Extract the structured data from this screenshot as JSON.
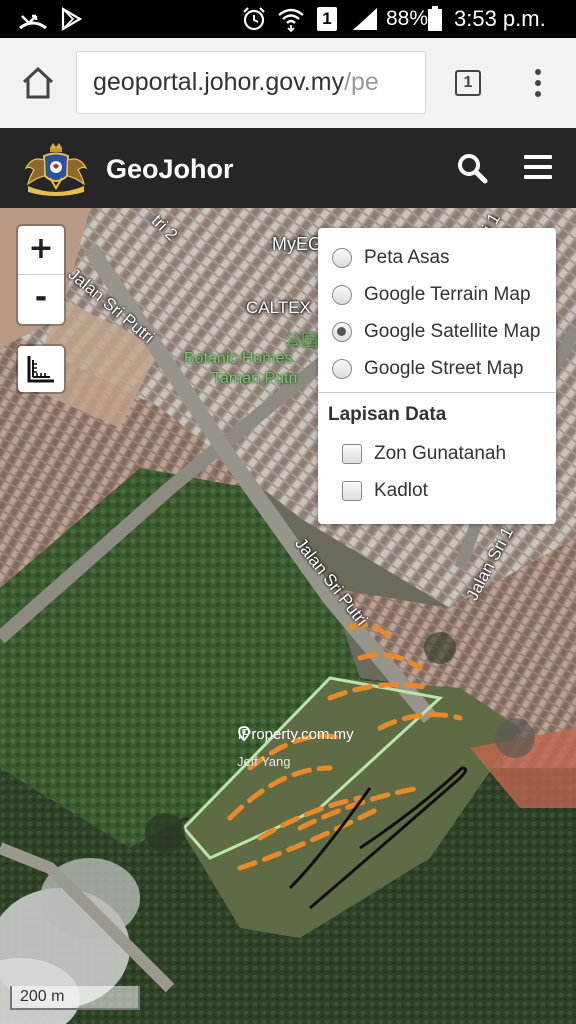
{
  "status_bar": {
    "battery_percent": "88%",
    "time": "3:53 p.m.",
    "sim_indicator": "1",
    "icons": [
      "missed-call-icon",
      "play-store-icon",
      "alarm-icon",
      "wifi-icon",
      "sim-icon",
      "signal-icon",
      "battery-icon"
    ]
  },
  "browser": {
    "url_host": "geoportal.johor.gov.my",
    "url_path": "/pe",
    "tab_count": "1",
    "icons": [
      "home-icon",
      "tabs-icon",
      "overflow-menu-icon"
    ]
  },
  "site": {
    "title": "GeoJohor",
    "icons": [
      "johor-crest-logo",
      "search-icon",
      "hamburger-menu-icon"
    ]
  },
  "map": {
    "zoom_in_label": "+",
    "zoom_out_label": "-",
    "base_layers": [
      {
        "label": "Peta Asas",
        "selected": false
      },
      {
        "label": "Google Terrain Map",
        "selected": false
      },
      {
        "label": "Google Satellite Map",
        "selected": true
      },
      {
        "label": "Google Street Map",
        "selected": false
      }
    ],
    "data_layers_heading": "Lapisan Data",
    "data_layers": [
      {
        "label": "Zon Gunatanah",
        "checked": false
      },
      {
        "label": "Kadlot",
        "checked": false
      }
    ],
    "scale_label": "200 m",
    "labels": {
      "road_1": "Jalan Sri Putri",
      "road_2": "Jalan Sri Putri",
      "road_3": "Jalan Sri 1",
      "road_top": "tri 2",
      "road_top_right": "Sri 1",
      "poi_myeg": "MyEG",
      "poi_caltex": "CALTEX",
      "poi_park_glyph": "公园",
      "poi_park_1": "Botanic Homes",
      "poi_park_2": "Taman Putri"
    },
    "watermark": "iProperty.com.my",
    "watermark_author": "Jeff Yang"
  }
}
